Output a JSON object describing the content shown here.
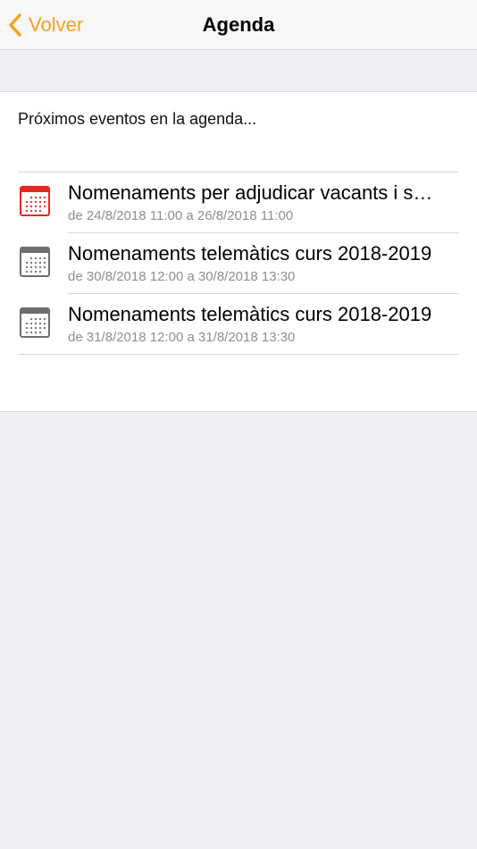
{
  "navbar": {
    "back_label": "Volver",
    "title": "Agenda",
    "accent_color": "#f5a21d"
  },
  "intro_text": "Próximos eventos en la agenda...",
  "events": [
    {
      "title": "Nomenaments per adjudicar vacants i s…",
      "dates": "de 24/8/2018 11:00 a 26/8/2018 11:00",
      "icon": "calendar-icon",
      "icon_color": "#e8261f"
    },
    {
      "title": "Nomenaments telemàtics curs 2018-2019",
      "dates": "de 30/8/2018 12:00 a 30/8/2018 13:30",
      "icon": "calendar-icon",
      "icon_color": "#6d6d72"
    },
    {
      "title": "Nomenaments telemàtics curs 2018-2019",
      "dates": "de 31/8/2018 12:00 a 31/8/2018 13:30",
      "icon": "calendar-icon",
      "icon_color": "#6d6d72"
    }
  ]
}
